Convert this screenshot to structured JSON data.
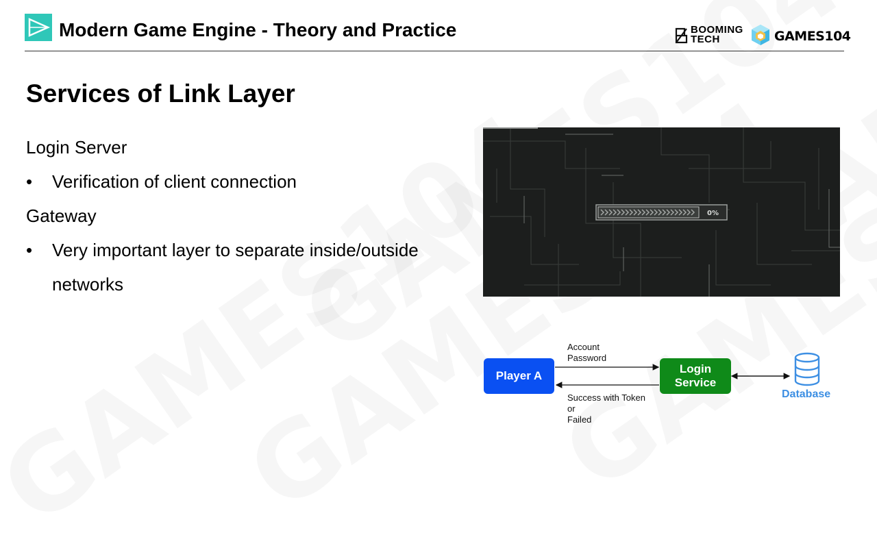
{
  "header": {
    "title": "Modern Game Engine - Theory and Practice",
    "booming_line1": "BOOMING",
    "booming_line2": "TECH",
    "games_logo": "GAMES104"
  },
  "watermark": "GAMES104",
  "slide": {
    "title": "Services of Link Layer",
    "sections": [
      {
        "heading": "Login Server",
        "bullets": [
          "Verification of client connection"
        ]
      },
      {
        "heading": "Gateway",
        "bullets": [
          "Very important layer to separate inside/outside",
          "networks"
        ]
      }
    ],
    "bullet_glyph": "•"
  },
  "loading_video": {
    "progress_text": "0%",
    "progress_value": 0
  },
  "diagram": {
    "player": "Player A",
    "login_service_line1": "Login",
    "login_service_line2": "Service",
    "request_label_line1": "Account",
    "request_label_line2": "Password",
    "response_label_line1": "Success with Token",
    "response_label_line2": "or",
    "response_label_line3": "Failed",
    "database_label": "Database",
    "colors": {
      "player_box": "#0a50f2",
      "login_box": "#0f8a19",
      "database": "#3d8fe3"
    }
  }
}
